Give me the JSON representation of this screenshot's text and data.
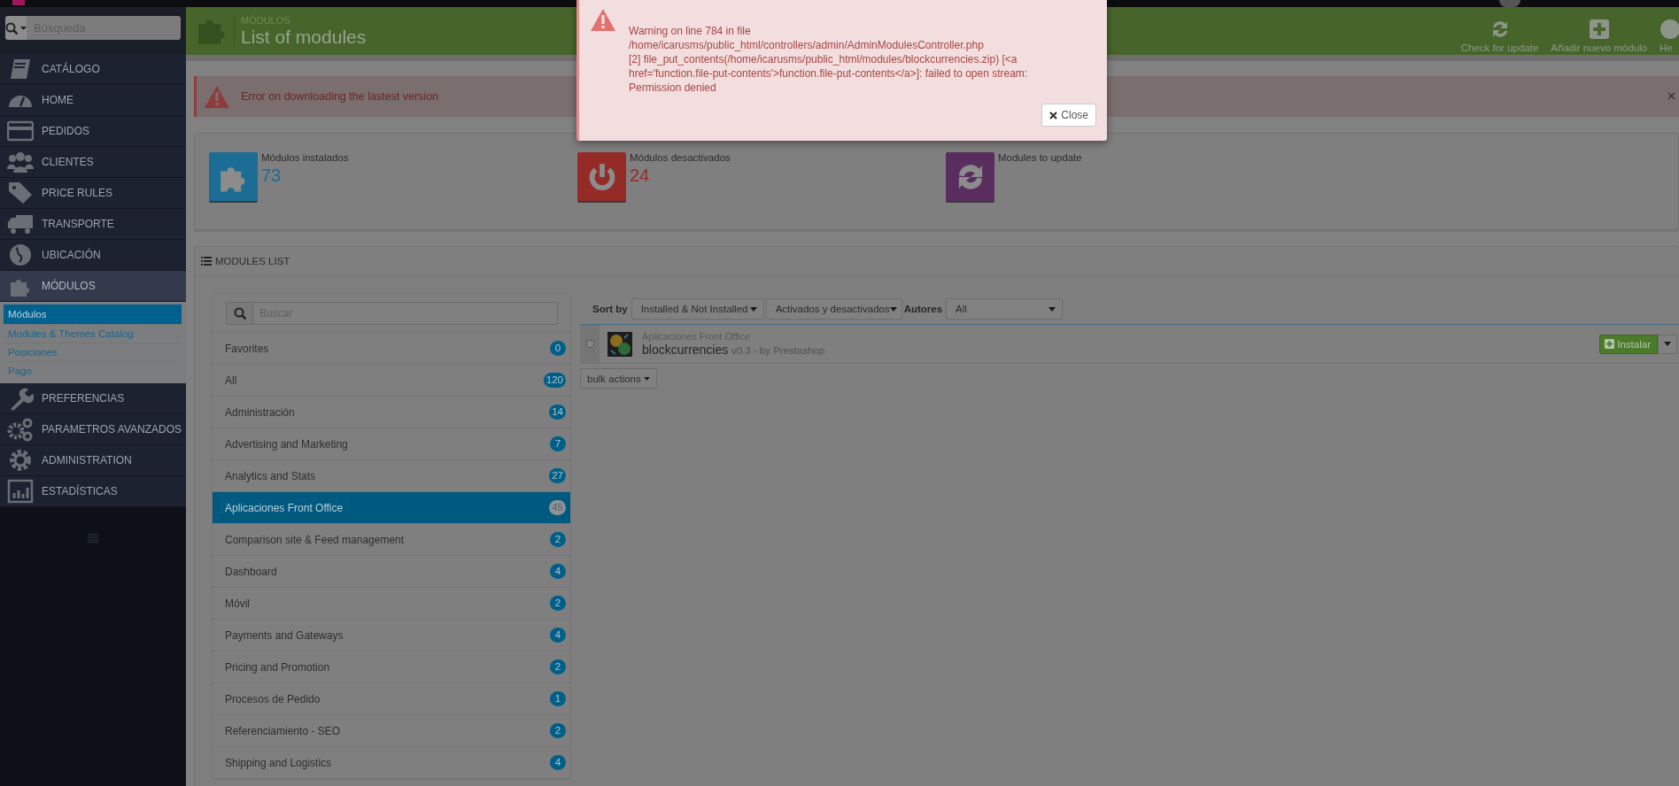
{
  "sidebar": {
    "search": {
      "placeholder": "Búsqueda"
    },
    "menu": [
      {
        "label": "CATÁLOGO",
        "selected": false
      },
      {
        "label": "HOME",
        "selected": false
      },
      {
        "label": "PEDIDOS",
        "selected": false
      },
      {
        "label": "CLIENTES",
        "selected": false
      },
      {
        "label": "PRICE RULES",
        "selected": false
      },
      {
        "label": "TRANSPORTE",
        "selected": false
      },
      {
        "label": "UBICACIÓN",
        "selected": false
      },
      {
        "label": "MÓDULOS",
        "selected": true,
        "children": [
          {
            "label": "Módulos",
            "selected": true
          },
          {
            "label": "Modules & Themes Catalog",
            "selected": false
          },
          {
            "label": "Posiciones",
            "selected": false
          },
          {
            "label": "Pago",
            "selected": false
          }
        ]
      },
      {
        "label": "PREFERENCIAS",
        "selected": false
      },
      {
        "label": "PARAMETROS AVANZADOS",
        "selected": false
      },
      {
        "label": "ADMINISTRATION",
        "selected": false
      },
      {
        "label": "ESTADÍSTICAS",
        "selected": false
      }
    ]
  },
  "header": {
    "breadcrumb": "MÓDULOS",
    "title": "List of modules",
    "toolbar": [
      {
        "label": "Check for update"
      },
      {
        "label": "Añadir nuevo módulo"
      },
      {
        "label": "He"
      }
    ]
  },
  "alert": {
    "message": "Error on downloading the lastest version",
    "close": "×"
  },
  "stats": [
    {
      "label": "Módulos instalados",
      "value": "73",
      "color": "#1b6d96"
    },
    {
      "label": "Módulos desactivados",
      "value": "24",
      "color": "#952b27"
    },
    {
      "label": "Modules to update",
      "color": "#592e5e"
    }
  ],
  "modules_list": {
    "title": "MODULES LIST",
    "search": {
      "placeholder": "Buscar"
    },
    "categories": [
      {
        "label": "Favorites",
        "count": "0",
        "selected": false
      },
      {
        "label": "All",
        "count": "120",
        "selected": false
      },
      {
        "label": "Administración",
        "count": "14",
        "selected": false
      },
      {
        "label": "Advertising and Marketing",
        "count": "7",
        "selected": false
      },
      {
        "label": "Analytics and Stats",
        "count": "27",
        "selected": false
      },
      {
        "label": "Aplicaciones Front Office",
        "count": "45",
        "selected": true
      },
      {
        "label": "Comparison site & Feed management",
        "count": "2",
        "selected": false
      },
      {
        "label": "Dashboard",
        "count": "4",
        "selected": false
      },
      {
        "label": "Móvil",
        "count": "2",
        "selected": false
      },
      {
        "label": "Payments and Gateways",
        "count": "4",
        "selected": false
      },
      {
        "label": "Pricing and Promotion",
        "count": "2",
        "selected": false
      },
      {
        "label": "Procesos de Pedido",
        "count": "1",
        "selected": false
      },
      {
        "label": "Referenciamiento - SEO",
        "count": "2",
        "selected": false
      },
      {
        "label": "Shipping and Logistics",
        "count": "4",
        "selected": false
      }
    ],
    "sort_label": "Sort by",
    "filters": [
      "Installed & Not Installed",
      "Activados y desactivados"
    ],
    "authors_label": "Autores",
    "authors": "All",
    "modules": [
      {
        "category": "Aplicaciones Front Office",
        "name": "blockcurrencies",
        "version": "v0.3 - by Prestashop",
        "checked": false,
        "action": "Instalar"
      }
    ],
    "bulk_actions": "bulk actions"
  },
  "dialog": {
    "lines": [
      "Warning on line 784 in file",
      "/home/icarusms/public_html/controllers/admin/AdminModulesController.php",
      "[2] file_put_contents(/home/icarusms/public_html/modules/blockcurrencies.zip) [<a",
      "href='function.file-put-contents'>function.file-put-contents</a>]: failed to open stream:",
      "Permission denied"
    ],
    "close": "Close"
  }
}
